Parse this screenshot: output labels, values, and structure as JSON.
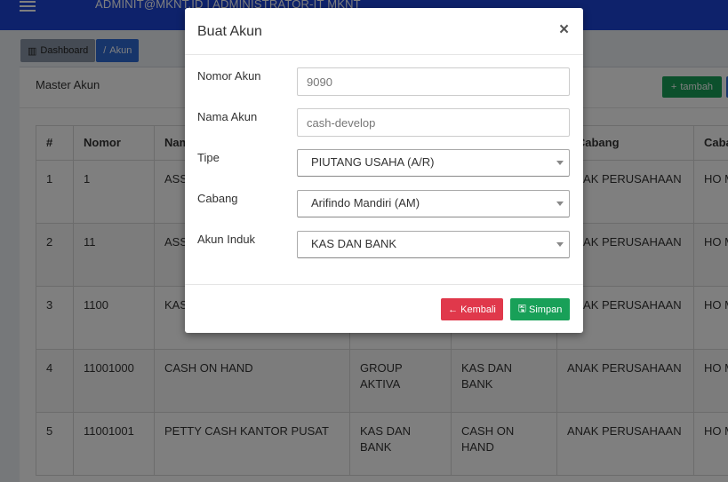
{
  "navbar": {
    "menu_icon": "hamburger-icon",
    "user": "ADMINIT@MKNT.ID | ADMINISTRATOR-IT MKNT"
  },
  "breadcrumb": {
    "dashboard_label": "Dashboard",
    "dashboard_icon": "chart-icon",
    "akun_label": "Akun",
    "akun_icon": "slash-icon"
  },
  "box": {
    "title": "Master Akun",
    "tambah_label": "tambah",
    "tambah_icon": "plus-icon"
  },
  "table": {
    "headers": [
      "#",
      "Nomor",
      "Nama",
      "",
      "",
      "Tipe Cabang",
      "Cabang"
    ],
    "header_visible": [
      "#",
      "Nomor",
      "Nam",
      "",
      "",
      "e Cabang",
      "Caba"
    ],
    "rows": [
      [
        "1",
        "1",
        "ASS",
        "",
        "",
        "ANAK PERUSAHAAN",
        "HO M"
      ],
      [
        "2",
        "11",
        "ASS",
        "",
        "",
        "ANAK PERUSAHAAN",
        "HO M"
      ],
      [
        "3",
        "1100",
        "KAS",
        "",
        "",
        "ANAK PERUSAHAAN",
        "HO M"
      ],
      [
        "4",
        "11001000",
        "CASH ON HAND",
        "GROUP AKTIVA",
        "KAS DAN BANK",
        "ANAK PERUSAHAAN",
        "HO M"
      ],
      [
        "5",
        "11001001",
        "PETTY CASH KANTOR PUSAT",
        "KAS DAN BANK",
        "CASH ON HAND",
        "ANAK PERUSAHAAN",
        "HO M"
      ]
    ]
  },
  "modal": {
    "title": "Buat Akun",
    "close_label": "×",
    "fields": {
      "nomor_label": "Nomor Akun",
      "nomor_placeholder": "9090",
      "nama_label": "Nama Akun",
      "nama_placeholder": "cash-develop",
      "tipe_label": "Tipe",
      "tipe_value": "PIUTANG USAHA (A/R)",
      "cabang_label": "Cabang",
      "cabang_value": "Arifindo Mandiri (AM)",
      "induk_label": "Akun Induk",
      "induk_value": "KAS DAN BANK"
    },
    "kembali_label": "Kembali",
    "kembali_icon": "arrow-left-icon",
    "simpan_label": "Simpan",
    "simpan_icon": "save-icon"
  },
  "colors": {
    "navbar": "#1d45d6",
    "primary": "#2e6ad4",
    "success": "#18a058",
    "danger": "#e0384b"
  }
}
